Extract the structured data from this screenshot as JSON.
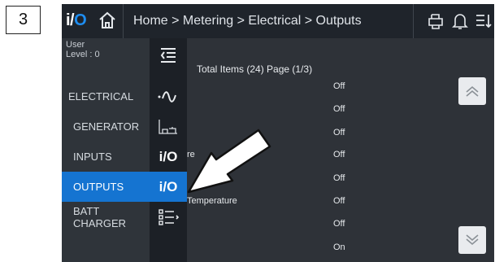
{
  "step_number": "3",
  "topbar": {
    "logo_text_i": "i/",
    "logo_text_o": "O",
    "breadcrumb": "Home > Metering > Electrical > Outputs"
  },
  "user": {
    "label": "User",
    "level": "Level : 0"
  },
  "sidebar": {
    "items": [
      {
        "label": "ELECTRICAL",
        "active": false
      },
      {
        "label": "GENERATOR",
        "active": false
      },
      {
        "label": "INPUTS",
        "active": false
      },
      {
        "label": "OUTPUTS",
        "active": true
      },
      {
        "label": "BATT CHARGER",
        "active": false
      }
    ]
  },
  "icons": {
    "io_label_i": "i/",
    "io_label_o": "O"
  },
  "content": {
    "total_items": "Total Items (24) Page (1/3)",
    "rows": [
      {
        "name": "",
        "value": "Off"
      },
      {
        "name": "",
        "value": "Off"
      },
      {
        "name": "",
        "value": "Off"
      },
      {
        "name": "re",
        "value": "Off"
      },
      {
        "name": "",
        "value": "Off"
      },
      {
        "name": "Temperature",
        "value": "Off"
      },
      {
        "name": "",
        "value": "Off"
      },
      {
        "name": "",
        "value": "On"
      }
    ]
  },
  "colors": {
    "accent": "#1574d1",
    "topbar": "#1f242b",
    "background": "#2e3238"
  },
  "icon_names": [
    "home-icon",
    "printer-icon",
    "bell-icon",
    "menu-icon",
    "collapse-icon",
    "sine-wave-icon",
    "generator-chart-icon",
    "list-icon",
    "chevron-up-icon",
    "chevron-down-icon"
  ]
}
